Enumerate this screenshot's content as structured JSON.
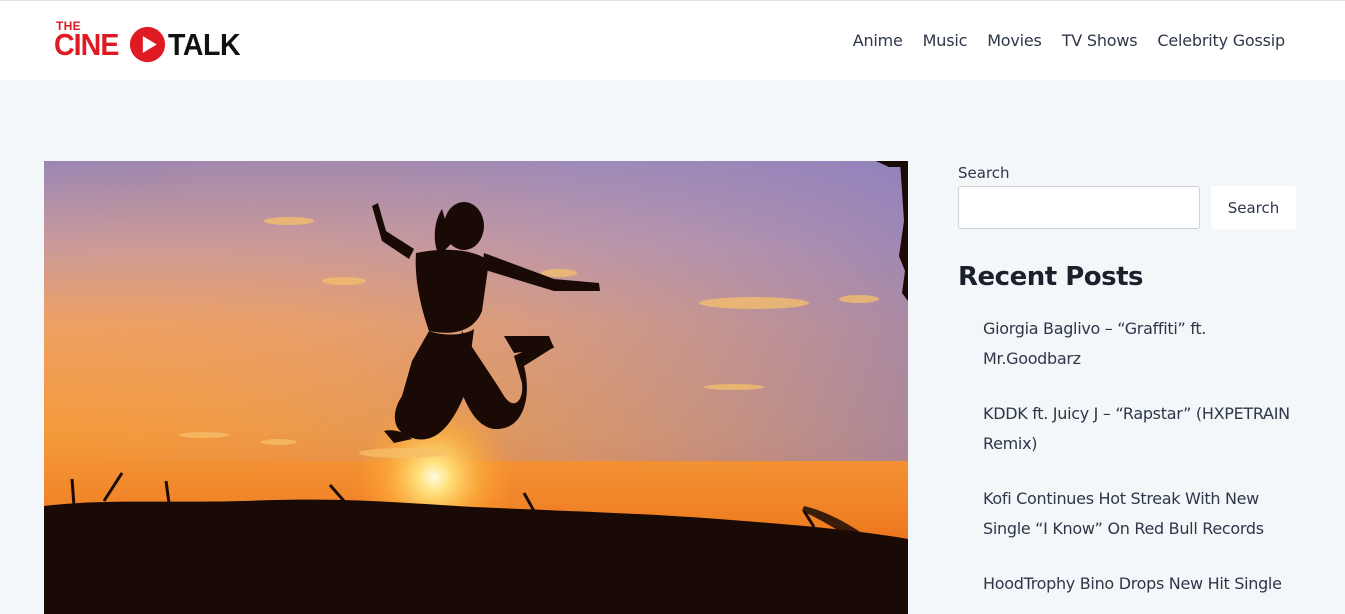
{
  "logo": {
    "the": "THE",
    "cine": "CINE",
    "talk": "TALK"
  },
  "nav": [
    "Anime",
    "Music",
    "Movies",
    "TV Shows",
    "Celebrity Gossip"
  ],
  "search": {
    "label": "Search",
    "placeholder": "",
    "button_label": "Search"
  },
  "recent_posts": {
    "title": "Recent Posts",
    "items": [
      "Giorgia Baglivo – “Graffiti” ft. Mr.Goodbarz",
      "KDDK ft. Juicy J – “Rapstar” (HXPETRAIN Remix)",
      "Kofi Continues Hot Streak With New Single “I Know” On Red Bull Records",
      "HoodTrophy Bino Drops New Hit Single"
    ]
  },
  "colors": {
    "brand_red": "#e01a22",
    "header_bg": "#ffffff",
    "page_bg": "#f4f7fa"
  }
}
